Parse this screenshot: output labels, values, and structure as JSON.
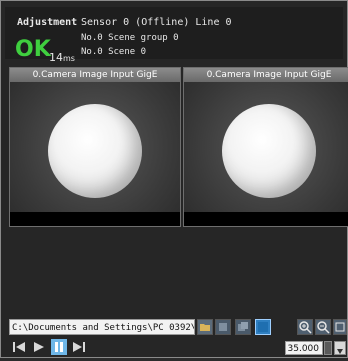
{
  "header": {
    "mode_label": "Adjustment",
    "line1": "Sensor 0 (Offline) Line 0",
    "line2": "No.0 Scene group 0",
    "line3": "No.0 Scene 0",
    "judgement": "OK",
    "time_value": "14",
    "time_unit": "ms",
    "judgement_color": "#3fcf3f"
  },
  "panels": [
    {
      "title": "0.Camera Image Input GigE"
    },
    {
      "title": "0.Camera Image Input GigE"
    }
  ],
  "toolbar": {
    "path_value": "C:\\Documents and Settings\\PC 0392\\My",
    "icons": [
      "folder-open-icon",
      "save-icon",
      "save-all-icon",
      "blue-square-icon",
      "zoom-in-icon",
      "zoom-out-icon",
      "fit-icon"
    ]
  },
  "playback": {
    "icons": [
      "skip-first-icon",
      "play-icon",
      "pause-icon",
      "skip-last-icon"
    ],
    "speed_value": "35.000"
  }
}
